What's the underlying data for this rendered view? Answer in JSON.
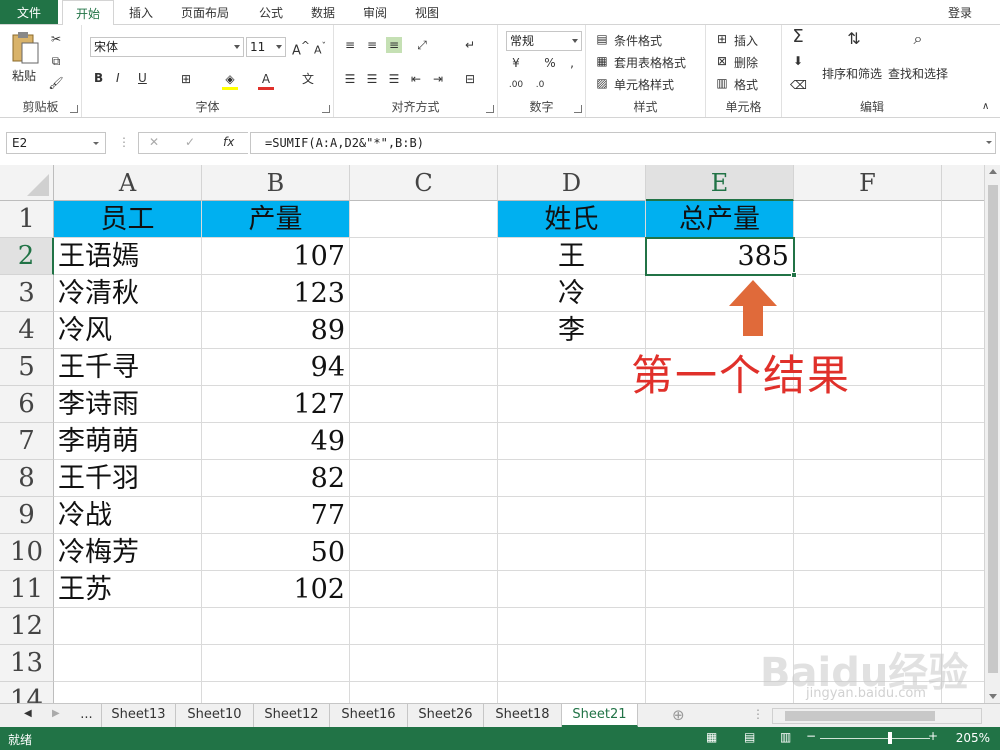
{
  "ribbon": {
    "file_tab": "文件",
    "tabs": [
      "开始",
      "插入",
      "页面布局",
      "公式",
      "数据",
      "审阅",
      "视图"
    ],
    "login": "登录",
    "groups": {
      "clipboard": {
        "label": "剪贴板",
        "paste": "粘贴"
      },
      "font": {
        "label": "字体",
        "font_name": "宋体",
        "font_size": "11",
        "bold": "B",
        "italic": "I",
        "underline": "U"
      },
      "alignment": {
        "label": "对齐方式"
      },
      "number": {
        "label": "数字",
        "format": "常规"
      },
      "styles": {
        "label": "样式",
        "conditional": "条件格式",
        "table": "套用表格格式",
        "cell": "单元格样式"
      },
      "cells": {
        "label": "单元格",
        "insert": "插入",
        "delete": "删除",
        "format": "格式"
      },
      "editing": {
        "label": "编辑",
        "sort": "排序和筛选",
        "find": "查找和选择"
      }
    }
  },
  "formula_bar": {
    "name_box": "E2",
    "fx": "fx",
    "formula": "=SUMIF(A:A,D2&\"*\",B:B)"
  },
  "sheet": {
    "columns": [
      "A",
      "B",
      "C",
      "D",
      "E",
      "F"
    ],
    "selected_column": "E",
    "selected_row": "2",
    "rows": [
      "1",
      "2",
      "3",
      "4",
      "5",
      "6",
      "7",
      "8",
      "9",
      "10",
      "11",
      "12",
      "13",
      "14"
    ],
    "table1": {
      "headers": [
        "员工",
        "产量"
      ],
      "data": [
        [
          "王语嫣",
          "107"
        ],
        [
          "冷清秋",
          "123"
        ],
        [
          "冷风",
          "89"
        ],
        [
          "王千寻",
          "94"
        ],
        [
          "李诗雨",
          "127"
        ],
        [
          "李萌萌",
          "49"
        ],
        [
          "王千羽",
          "82"
        ],
        [
          "冷战",
          "77"
        ],
        [
          "冷梅芳",
          "50"
        ],
        [
          "王苏",
          "102"
        ]
      ]
    },
    "table2": {
      "headers": [
        "姓氏",
        "总产量"
      ],
      "surnames": [
        "王",
        "冷",
        "李"
      ],
      "results": [
        "385",
        "",
        ""
      ]
    },
    "annotation": "第一个结果",
    "accent_color": "#217346",
    "header_fill": "#00b0f0",
    "annotation_color": "#e0302a"
  },
  "sheet_tabs": {
    "more": "...",
    "tabs": [
      "Sheet13",
      "Sheet10",
      "Sheet12",
      "Sheet16",
      "Sheet26",
      "Sheet18",
      "Sheet21"
    ],
    "active": "Sheet21"
  },
  "status": {
    "ready": "就绪",
    "zoom": "205%"
  },
  "watermark": {
    "text": "Baidu经验",
    "sub": "jingyan.baidu.com"
  }
}
